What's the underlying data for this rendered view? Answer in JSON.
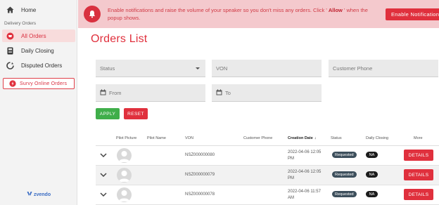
{
  "sidebar": {
    "home_label": "Home",
    "section_label": "Delivery Orders",
    "items": [
      {
        "label": "All Orders",
        "icon": "orders-icon"
      },
      {
        "label": "Daily Closing",
        "icon": "closing-icon"
      },
      {
        "label": "Disputed Orders",
        "icon": "disputed-icon"
      }
    ],
    "survey_label": "Survy Online Orders",
    "logo_text": "zvendo"
  },
  "banner": {
    "text_before": "Enable notifications and raise the volume of your speaker so you don't miss any orders. Click ' ",
    "highlight": "Allow",
    "text_after": " ' when the popup shows.",
    "button_label": "Enable Notifications"
  },
  "page": {
    "title": "Orders List"
  },
  "filters": {
    "status_placeholder": "Status",
    "von_placeholder": "VON",
    "phone_placeholder": "Customer Phone",
    "from_placeholder": "From",
    "to_placeholder": "To",
    "apply_label": "APPLY",
    "reset_label": "RESET"
  },
  "table": {
    "headers": {
      "pilot_picture": "Pilot Picture",
      "pilot_name": "Pilot Name",
      "von": "VON",
      "customer_phone": "Customer Phone",
      "creation_date": "Creation Date",
      "status": "Status",
      "daily_closing": "Daily Closing",
      "more": "More"
    },
    "rows": [
      {
        "von": "NSZ000000080",
        "date_line1": "2022-04-06 12:05",
        "date_line2": "PM",
        "status": "Requested",
        "closing": "NA",
        "action": "DETAILS"
      },
      {
        "von": "NSZ000000079",
        "date_line1": "2022-04-06 12:05",
        "date_line2": "PM",
        "status": "Requested",
        "closing": "NA",
        "action": "DETAILS"
      },
      {
        "von": "NSZ000000078",
        "date_line1": "2022-04-06 11:57",
        "date_line2": "AM",
        "status": "Requested",
        "closing": "NA",
        "action": "DETAILS"
      }
    ]
  },
  "colors": {
    "accent": "#e0303d",
    "apply": "#3fae4a",
    "banner_bg": "#f4c9cd"
  }
}
